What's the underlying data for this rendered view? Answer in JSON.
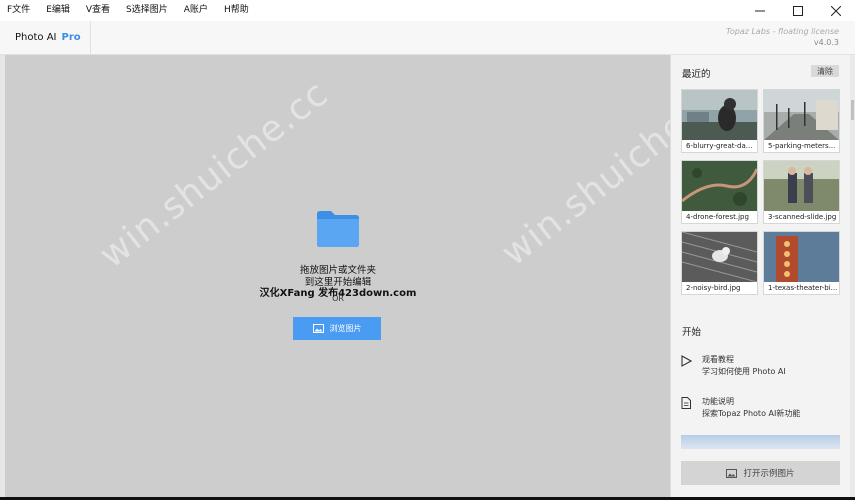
{
  "menu": {
    "items": [
      {
        "label": "F文件"
      },
      {
        "label": "E编辑"
      },
      {
        "label": "V查看"
      },
      {
        "label": "S选择图片"
      },
      {
        "label": "A账户"
      },
      {
        "label": "H帮助"
      }
    ]
  },
  "window_controls": {
    "minimize_icon": "minimize-icon",
    "maximize_icon": "maximize-icon",
    "close_icon": "close-icon"
  },
  "header": {
    "app_name": "Photo AI",
    "edition": "Pro",
    "license": "Topaz Labs - floating license",
    "version": "v4.0.3"
  },
  "drop_zone": {
    "line1": "拖放图片或文件夹",
    "line2": "到这里开始编辑",
    "line3": "汉化XFang 发布423down.com",
    "or": "OR",
    "browse_label": "浏览图片"
  },
  "watermark": "win.shuiche.cc",
  "recent": {
    "title": "最近的",
    "clear_label": "清除",
    "items": [
      {
        "label": "6-blurry-great-da..."
      },
      {
        "label": "5-parking-meters..."
      },
      {
        "label": "4-drone-forest.jpg"
      },
      {
        "label": "3-scanned-slide.jpg"
      },
      {
        "label": "2-noisy-bird.jpg"
      },
      {
        "label": "1-texas-theater-bi..."
      }
    ]
  },
  "start": {
    "title": "开始",
    "items": [
      {
        "title": "观看教程",
        "subtitle": "学习如何使用 Photo AI",
        "icon": "play-icon"
      },
      {
        "title": "功能说明",
        "subtitle": "探索Topaz Photo AI新功能",
        "icon": "document-icon"
      }
    ],
    "sample_label": "打开示例图片"
  },
  "colors": {
    "accent": "#4a9cf3",
    "canvas": "#cdcdcd",
    "panel": "#f3f3f3"
  }
}
